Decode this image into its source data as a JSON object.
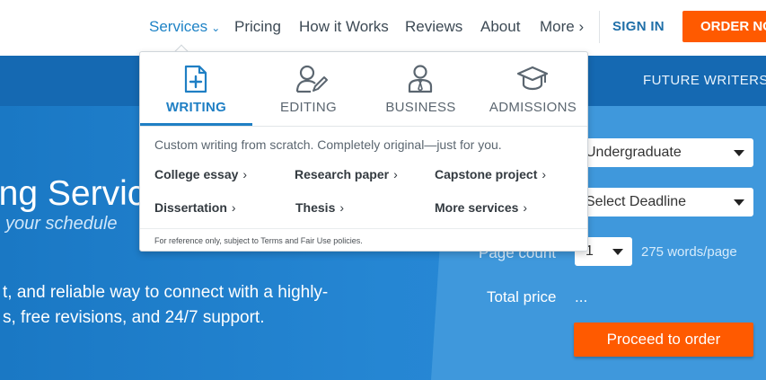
{
  "nav": {
    "services": "Services",
    "pricing": "Pricing",
    "how_it_works": "How it Works",
    "reviews": "Reviews",
    "about": "About",
    "more": "More",
    "sign_in": "SIGN IN",
    "order_now": "ORDER NOW",
    "chevron_down": "⌄",
    "chevron_right": "›"
  },
  "dropdown": {
    "tabs": [
      {
        "label": "WRITING",
        "icon": "document-plus-icon",
        "active": true
      },
      {
        "label": "EDITING",
        "icon": "user-pencil-icon",
        "active": false
      },
      {
        "label": "BUSINESS",
        "icon": "business-person-icon",
        "active": false
      },
      {
        "label": "ADMISSIONS",
        "icon": "graduation-cap-icon",
        "active": false
      }
    ],
    "description": "Custom writing from scratch. Completely original—just for you.",
    "links": [
      {
        "label": "College essay"
      },
      {
        "label": "Research paper"
      },
      {
        "label": "Capstone project"
      },
      {
        "label": "Dissertation"
      },
      {
        "label": "Thesis"
      },
      {
        "label": "More services"
      }
    ],
    "link_chevron": "›",
    "footnote": "For reference only, subject to Terms and Fair Use policies."
  },
  "hero": {
    "tab_future": "FUTURE WRITERS",
    "title": "ing Servic",
    "subtitle": " your schedule",
    "description": "t, and reliable way to connect with a highly-\ns, free revisions, and 24/7 support."
  },
  "calculator": {
    "level": "Undergraduate",
    "deadline": "Select Deadline",
    "pages": "1",
    "page_count_label": "Page count",
    "words_per_page": "275 words/page",
    "total_label": "Total price",
    "total_value": "...",
    "proceed": "Proceed to order"
  },
  "colors": {
    "accent": "#1f83c6",
    "order": "#ff5a00",
    "hero": "#2586d3"
  }
}
